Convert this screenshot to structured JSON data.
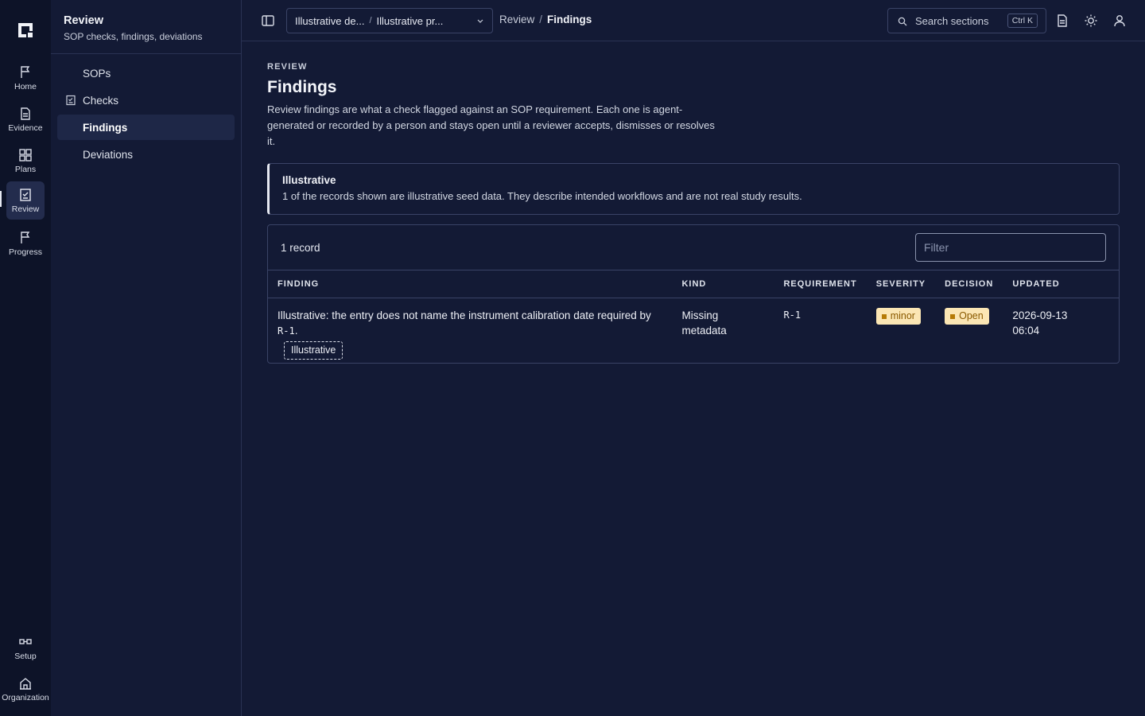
{
  "rail": {
    "items": [
      {
        "label": "Home",
        "icon": "flag-icon"
      },
      {
        "label": "Evidence",
        "icon": "document-icon"
      },
      {
        "label": "Plans",
        "icon": "grid-icon"
      },
      {
        "label": "Review",
        "icon": "checklist-icon",
        "active": true
      },
      {
        "label": "Progress",
        "icon": "flag-icon"
      }
    ],
    "bottom": [
      {
        "label": "Setup",
        "icon": "setup-icon"
      },
      {
        "label": "Organization",
        "icon": "building-icon"
      }
    ]
  },
  "sidebar": {
    "title": "Review",
    "subtitle": "SOP checks, findings, deviations",
    "items": [
      {
        "label": "SOPs"
      },
      {
        "label": "Checks",
        "icon": "checklist-icon"
      },
      {
        "label": "Findings",
        "active": true
      },
      {
        "label": "Deviations"
      }
    ]
  },
  "topbar": {
    "project_a": "Illustrative de...",
    "project_b": "Illustrative pr...",
    "breadcrumb": [
      "Review",
      "Findings"
    ],
    "search_label": "Search sections",
    "search_shortcut": "Ctrl K"
  },
  "page": {
    "eyebrow": "REVIEW",
    "title": "Findings",
    "description": "Review findings are what a check flagged against an SOP requirement. Each one is agent-generated or recorded by a person and stays open until a reviewer accepts, dismisses or resolves it."
  },
  "notice": {
    "title": "Illustrative",
    "text": "1 of the records shown are illustrative seed data. They describe intended workflows and are not real study results."
  },
  "table": {
    "count": "1 record",
    "filter_placeholder": "Filter",
    "columns": [
      "FINDING",
      "KIND",
      "REQUIREMENT",
      "SEVERITY",
      "DECISION",
      "UPDATED"
    ],
    "rows": [
      {
        "finding_prefix": "Illustrative: the entry does not name the instrument calibration date required by ",
        "finding_ref": "R-1",
        "finding_suffix": ".",
        "tag": "Illustrative",
        "kind": "Missing metadata",
        "requirement": "R-1",
        "severity": "minor",
        "decision": "Open",
        "updated_date": "2026-09-13",
        "updated_time": "06:04"
      }
    ]
  },
  "colors": {
    "background": "#131a35",
    "rail": "#0d1328",
    "pill_bg": "#fbe6b4",
    "pill_text": "#8a5a00"
  }
}
